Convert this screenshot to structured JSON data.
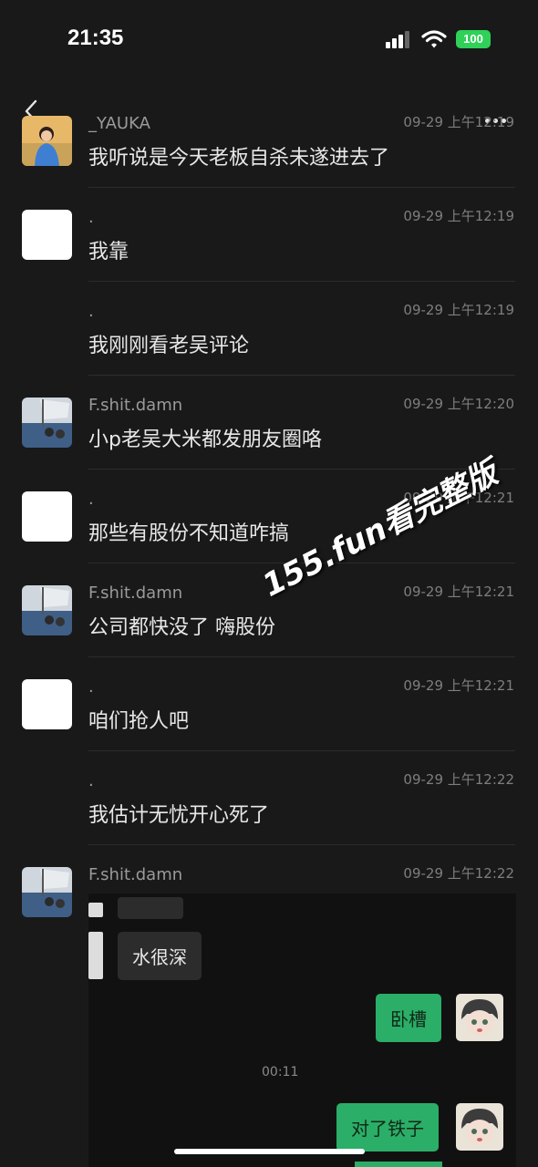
{
  "status": {
    "time": "21:35",
    "battery": "100"
  },
  "messages": [
    {
      "name": "_YAUKA",
      "stamp": "09-29 上午12:19",
      "text": "我听说是今天老板自杀未遂进去了",
      "avatar": "photo-person"
    },
    {
      "name": ".",
      "stamp": "09-29 上午12:19",
      "text": "我靠",
      "avatar": "white"
    },
    {
      "name": ".",
      "stamp": "09-29 上午12:19",
      "text": "我刚刚看老吴评论",
      "avatar": "none"
    },
    {
      "name": "F.shit.damn",
      "stamp": "09-29 上午12:20",
      "text": "小p老吴大米都发朋友圈咯",
      "avatar": "photo-boat"
    },
    {
      "name": ".",
      "stamp": "09-29 上午12:21",
      "text": "那些有股份不知道咋搞",
      "avatar": "white"
    },
    {
      "name": "F.shit.damn",
      "stamp": "09-29 上午12:21",
      "text": "公司都快没了  嗨股份",
      "avatar": "photo-boat"
    },
    {
      "name": ".",
      "stamp": "09-29 上午12:21",
      "text": "咱们抢人吧",
      "avatar": "white"
    },
    {
      "name": ".",
      "stamp": "09-29 上午12:22",
      "text": "我估计无忧开心死了",
      "avatar": "none"
    },
    {
      "name": "F.shit.damn",
      "stamp": "09-29 上午12:22",
      "text": "",
      "avatar": "photo-boat"
    }
  ],
  "embedded_chat": {
    "left_bubble": "水很深",
    "right_bubble_1": "卧槽",
    "call_time": "00:11",
    "right_bubble_2": "对了铁子"
  },
  "watermark": "155.fun看完整版",
  "colors": {
    "background": "#191919",
    "accent_green": "#2bae67",
    "battery_green": "#2fd158"
  }
}
